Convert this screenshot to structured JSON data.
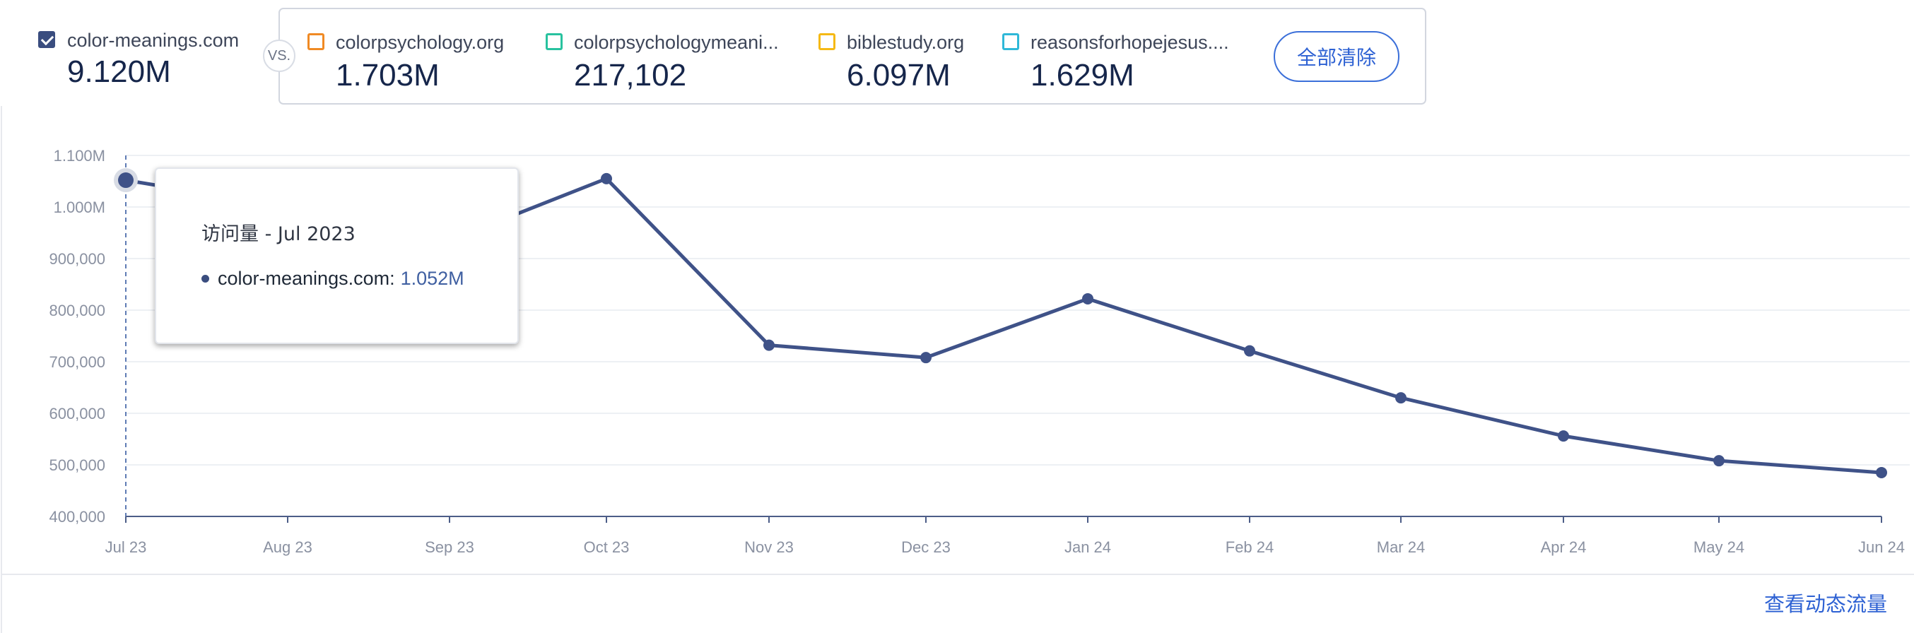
{
  "main_site": {
    "name": "color-meanings.com",
    "value": "9.120M",
    "checked": true
  },
  "compare": {
    "vs_label": "VS.",
    "competitors": [
      {
        "name": "colorpsychology.org",
        "value": "1.703M",
        "color": "#f08a24"
      },
      {
        "name": "colorpsychologymeani...",
        "value": "217,102",
        "color": "#28c29f"
      },
      {
        "name": "biblestudy.org",
        "value": "6.097M",
        "color": "#f5b915"
      },
      {
        "name": "reasonsforhopejesus....",
        "value": "1.629M",
        "color": "#2fb8d8"
      }
    ],
    "clear_all_label": "全部清除"
  },
  "tooltip": {
    "title": "访问量 - Jul 2023",
    "series_label": "color-meanings.com:",
    "series_value": "1.052M"
  },
  "bottom_link": "查看动态流量",
  "chart_data": {
    "type": "line",
    "title": "",
    "xlabel": "",
    "ylabel": "",
    "categories": [
      "Jul 23",
      "Aug 23",
      "Sep 23",
      "Oct 23",
      "Nov 23",
      "Dec 23",
      "Jan 24",
      "Feb 24",
      "Mar 24",
      "Apr 24",
      "May 24",
      "Jun 24"
    ],
    "series": [
      {
        "name": "color-meanings.com",
        "values": [
          1052000,
          1000000,
          935000,
          1055000,
          732000,
          708000,
          822000,
          721000,
          630000,
          556000,
          508000,
          485000
        ],
        "color": "#3f5288"
      }
    ],
    "ylim": [
      400000,
      1100000
    ],
    "y_ticks": [
      {
        "value": 400000,
        "label": "400,000"
      },
      {
        "value": 500000,
        "label": "500,000"
      },
      {
        "value": 600000,
        "label": "600,000"
      },
      {
        "value": 700000,
        "label": "700,000"
      },
      {
        "value": 800000,
        "label": "800,000"
      },
      {
        "value": 900000,
        "label": "900,000"
      },
      {
        "value": 1000000,
        "label": "1.000M"
      },
      {
        "value": 1100000,
        "label": "1.100M"
      }
    ],
    "grid": true,
    "highlighted_category": "Jul 23"
  }
}
